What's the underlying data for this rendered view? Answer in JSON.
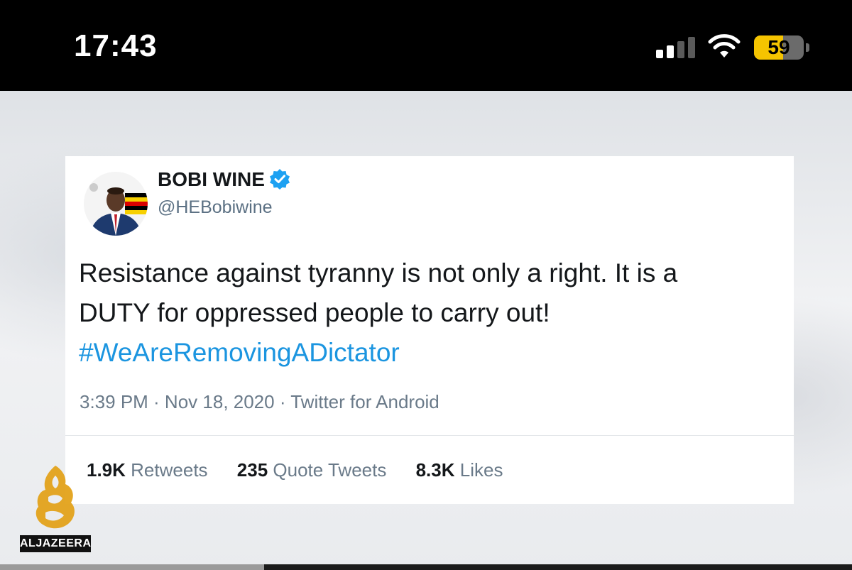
{
  "status_bar": {
    "time": "17:43",
    "signal_bars_active": 2,
    "battery_level": "59",
    "battery_fraction": 0.59,
    "icons": [
      "cellular-signal-icon",
      "wifi-icon",
      "battery-icon"
    ]
  },
  "tweet": {
    "author_name": "BOBI WINE",
    "author_handle": "@HEBobiwine",
    "verified": true,
    "text_lines": [
      "Resistance against tyranny is not only a right. It is a",
      "DUTY for oppressed people to carry out!"
    ],
    "hashtag": "#WeAreRemovingADictator",
    "meta": "3:39 PM · Nov 18, 2020 · Twitter for Android",
    "stats": [
      {
        "value": "1.9K",
        "label": "Retweets"
      },
      {
        "value": "235",
        "label": "Quote Tweets"
      },
      {
        "value": "8.3K",
        "label": "Likes"
      }
    ]
  },
  "broadcaster": {
    "wordmark": "ALJAZEERA"
  },
  "video": {
    "progress_fraction": 0.31
  },
  "colors": {
    "hashtag": "#1b95e0",
    "verified_badge": "#1da1f2",
    "battery_fill": "#f5c400",
    "aljazeera_gold": "#e3a21a"
  }
}
